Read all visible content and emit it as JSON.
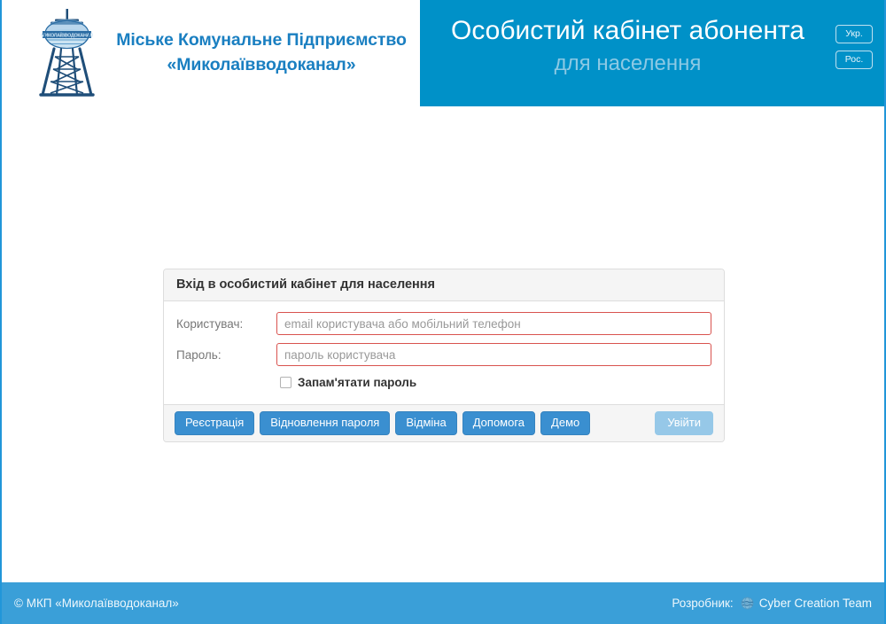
{
  "header": {
    "logo_icon": "water-tower-logo",
    "logo_inscription": "МИКОЛАЇВВОДОКАНАЛ",
    "company_line1": "Міське Комунальне Підприємство",
    "company_line2": "«Миколаївводоканал»",
    "cabinet_title": "Особистий кабінет абонента",
    "cabinet_subtitle": "для населення",
    "lang_buttons": [
      {
        "label": "Укр."
      },
      {
        "label": "Рос."
      }
    ]
  },
  "login_panel": {
    "heading": "Вхід в особистий кабінет для населення",
    "fields": [
      {
        "label": "Користувач:",
        "placeholder": "email користувача або мобільний телефон",
        "value": ""
      },
      {
        "label": "Пароль:",
        "placeholder": "пароль користувача",
        "value": ""
      }
    ],
    "remember_label": "Запам'ятати пароль",
    "remember_checked": false,
    "buttons": [
      {
        "label": "Реєстрація"
      },
      {
        "label": "Відновлення пароля"
      },
      {
        "label": "Відміна"
      },
      {
        "label": "Допомога"
      },
      {
        "label": "Демо"
      }
    ],
    "submit_label": "Увійти",
    "submit_disabled": true
  },
  "footer": {
    "copyright": "© МКП «Миколаївводоканал»",
    "developer_label": "Розробник:",
    "developer_icon": "globe-icon",
    "developer_name": "Cyber Creation Team"
  },
  "colors": {
    "header_blue": "#0091c8",
    "footer_blue": "#3a9fd8",
    "brand_text": "#1a7fc1",
    "button_blue": "#3a8fd0",
    "button_disabled": "#96c8e8",
    "input_border_red": "#d9534f",
    "page_border": "#2196d9",
    "subtitle_blue": "#8cc9e4"
  }
}
